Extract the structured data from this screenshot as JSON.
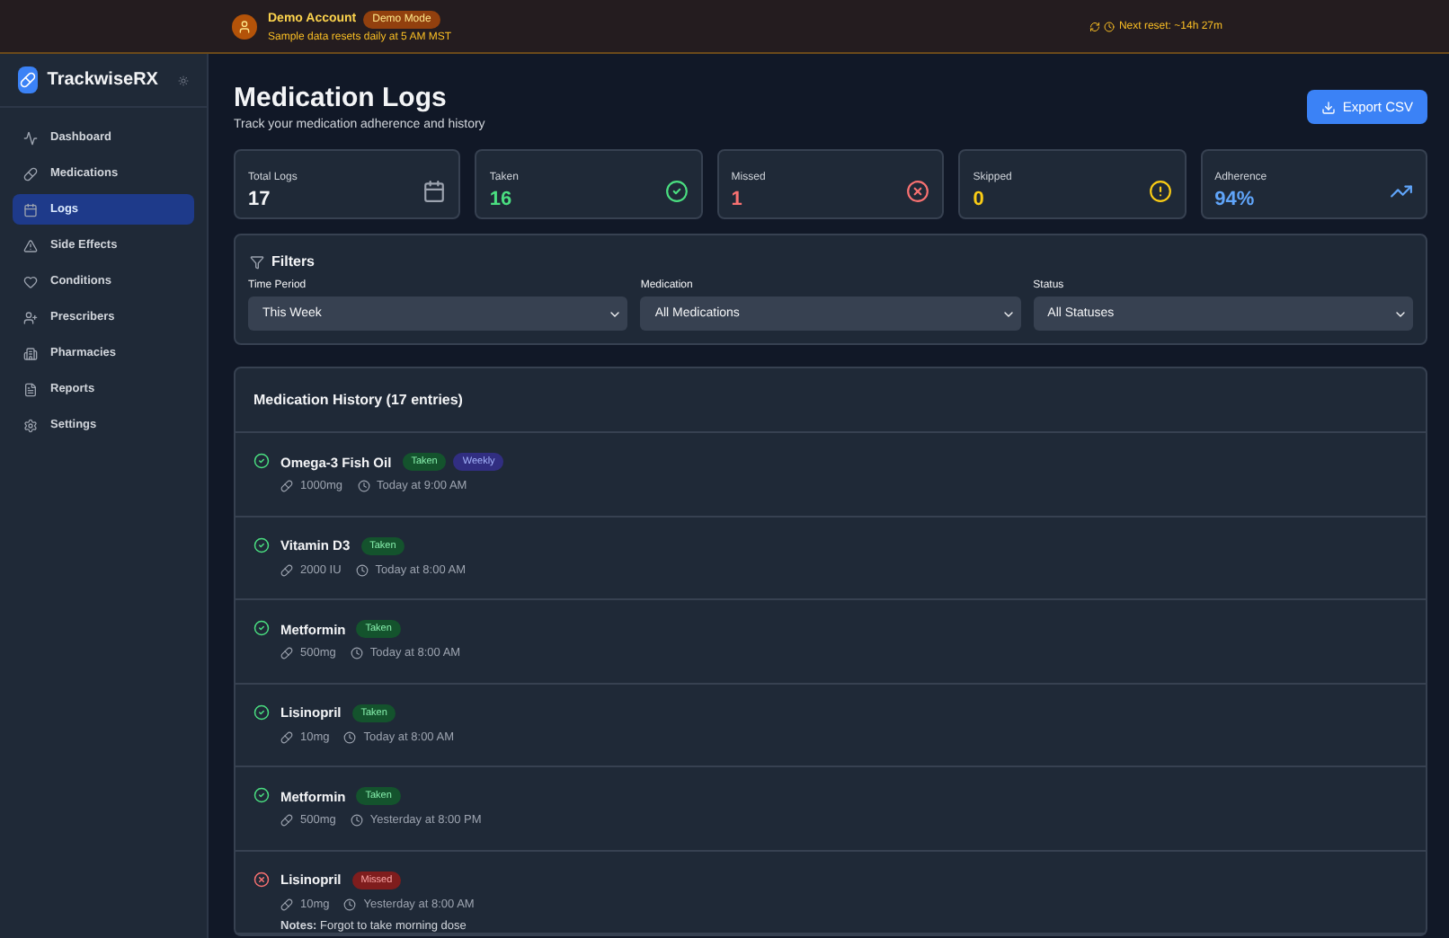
{
  "banner": {
    "account": "Demo Account",
    "badge": "Demo Mode",
    "subtitle": "Sample data resets daily at 5 AM MST",
    "reset": "Next reset: ~14h 27m"
  },
  "sidebar": {
    "brand": "TrackwiseRX",
    "items": [
      {
        "label": "Dashboard",
        "selected": false
      },
      {
        "label": "Medications",
        "selected": false
      },
      {
        "label": "Logs",
        "selected": true
      },
      {
        "label": "Side Effects",
        "selected": false
      },
      {
        "label": "Conditions",
        "selected": false
      },
      {
        "label": "Prescribers",
        "selected": false
      },
      {
        "label": "Pharmacies",
        "selected": false
      },
      {
        "label": "Reports",
        "selected": false
      },
      {
        "label": "Settings",
        "selected": false
      }
    ]
  },
  "header": {
    "title": "Medication Logs",
    "subtitle": "Track your medication adherence and history",
    "export_button": "Export CSV"
  },
  "stats": [
    {
      "kind": "total",
      "label": "Total Logs",
      "value": "17"
    },
    {
      "kind": "taken",
      "label": "Taken",
      "value": "16"
    },
    {
      "kind": "missed",
      "label": "Missed",
      "value": "1"
    },
    {
      "kind": "skipped",
      "label": "Skipped",
      "value": "0"
    },
    {
      "kind": "adherence",
      "label": "Adherence",
      "value": "94%"
    }
  ],
  "filters": {
    "title": "Filters",
    "fields": [
      {
        "label": "Time Period",
        "value": "This Week"
      },
      {
        "label": "Medication",
        "value": "All Medications"
      },
      {
        "label": "Status",
        "value": "All Statuses"
      }
    ]
  },
  "history": {
    "title": "Medication History (17 entries)",
    "entries": [
      {
        "kind": "taken",
        "name": "Omega-3 Fish Oil",
        "badge": "Taken",
        "tag": "Weekly",
        "dose": "1000mg",
        "time": "Today at 9:00 AM"
      },
      {
        "kind": "taken",
        "name": "Vitamin D3",
        "badge": "Taken",
        "dose": "2000 IU",
        "time": "Today at 8:00 AM"
      },
      {
        "kind": "taken",
        "name": "Metformin",
        "badge": "Taken",
        "dose": "500mg",
        "time": "Today at 8:00 AM"
      },
      {
        "kind": "taken",
        "name": "Lisinopril",
        "badge": "Taken",
        "dose": "10mg",
        "time": "Today at 8:00 AM"
      },
      {
        "kind": "taken",
        "name": "Metformin",
        "badge": "Taken",
        "dose": "500mg",
        "time": "Yesterday at 8:00 PM"
      },
      {
        "kind": "missed",
        "name": "Lisinopril",
        "badge": "Missed",
        "dose": "10mg",
        "time": "Yesterday at 8:00 AM",
        "notes": "**Notes:** Forgot to take morning dose"
      }
    ]
  }
}
